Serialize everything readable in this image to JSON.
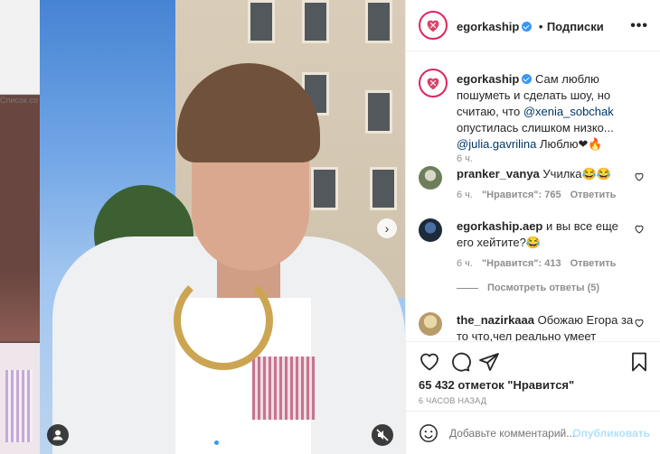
{
  "backdrop": {
    "text": "Список со"
  },
  "post": {
    "username": "egorkaship",
    "follow_separator": "•",
    "follow_label": "Подписки",
    "more": "•••"
  },
  "caption": {
    "username": "egorkaship",
    "text_before": "Сам люблю пошуметь и сделать шоу, но считаю, что ",
    "mention1": "@xenia_sobchak",
    "text_mid": " опустилась слишком низко... ",
    "mention2": "@julia.gavrilina",
    "text_after": " Люблю❤🔥",
    "time": "6 ч."
  },
  "comments": [
    {
      "username": "pranker_vanya",
      "text": "Училка😂😂",
      "time": "6 ч.",
      "likes": "\"Нравится\": 765",
      "reply": "Ответить"
    },
    {
      "username": "egorkaship.aep",
      "text": "и вы все еще его хейтите?😂",
      "time": "6 ч.",
      "likes": "\"Нравится\": 413",
      "reply": "Ответить"
    },
    {
      "username": "the_nazirkaaa",
      "text": "Обожаю Егора за то что,чел реально умеет"
    }
  ],
  "view_replies": "Посмотреть ответы (5)",
  "likes_text": "65 432 отметок \"Нравится\"",
  "time_caps": "6 ЧАСОВ НАЗАД",
  "add_comment": {
    "placeholder": "Добавьте комментарий...",
    "publish": "Опубликовать"
  },
  "colors": {
    "link": "#00376b",
    "verified": "#3897f0",
    "publish_disabled": "#b2dffc"
  }
}
